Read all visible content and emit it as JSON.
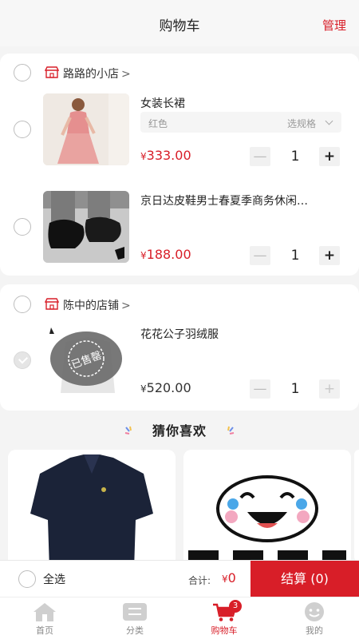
{
  "header": {
    "title": "购物车",
    "manage_label": "管理"
  },
  "shops": [
    {
      "name": "路路的小店",
      "items": [
        {
          "name": "女装长裙",
          "spec_value": "红色",
          "spec_choose": "选规格",
          "currency": "¥",
          "price": "333.00",
          "quantity": "1"
        },
        {
          "name": "京日达皮鞋男士春夏季商务休闲…",
          "currency": "¥",
          "price": "188.00",
          "quantity": "1"
        }
      ]
    },
    {
      "name": "陈中的店铺",
      "items": [
        {
          "name": "花花公子羽绒服",
          "currency": "¥",
          "price": "520.00",
          "quantity": "1",
          "status": "已售罄"
        }
      ]
    }
  ],
  "recommend": {
    "title": "猜你喜欢"
  },
  "checkout": {
    "select_all_label": "全选",
    "total_label": "合计:",
    "currency": "¥",
    "total_value": "0",
    "button_label": "结算 (0)"
  },
  "tabbar": {
    "tabs": [
      {
        "label": "首页",
        "icon": "home-icon"
      },
      {
        "label": "分类",
        "icon": "category-icon"
      },
      {
        "label": "购物车",
        "icon": "cart-icon",
        "badge": "3",
        "active": true
      },
      {
        "label": "我的",
        "icon": "profile-icon"
      }
    ]
  },
  "colors": {
    "accent": "#d81e28",
    "background": "#f4f4f4",
    "inactive_tab": "#888888"
  }
}
